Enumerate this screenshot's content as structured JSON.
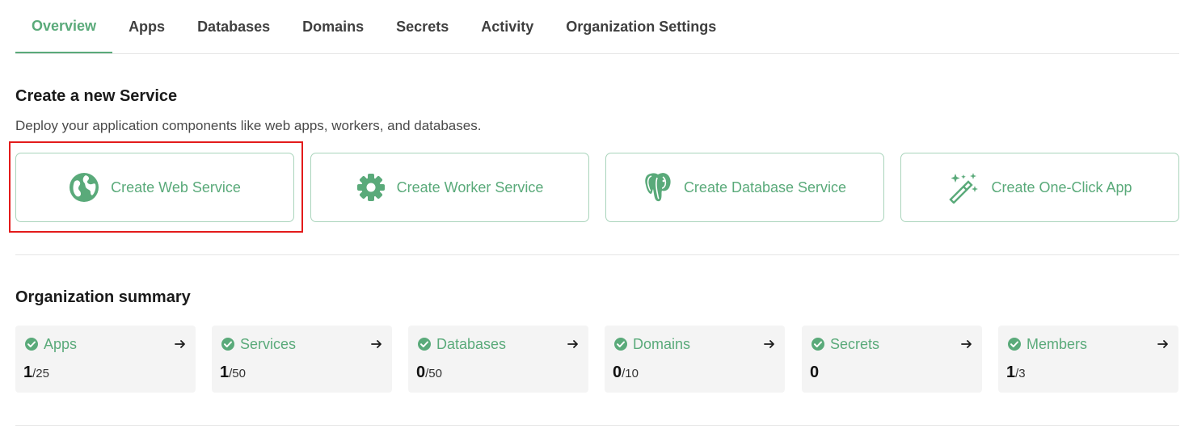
{
  "tabs": [
    {
      "label": "Overview"
    },
    {
      "label": "Apps"
    },
    {
      "label": "Databases"
    },
    {
      "label": "Domains"
    },
    {
      "label": "Secrets"
    },
    {
      "label": "Activity"
    },
    {
      "label": "Organization Settings"
    }
  ],
  "active_tab": "Overview",
  "create_section": {
    "title": "Create a new Service",
    "subtitle": "Deploy your application components like web apps, workers, and databases.",
    "cards": [
      {
        "label": "Create Web Service",
        "icon": "globe-icon"
      },
      {
        "label": "Create Worker Service",
        "icon": "gear-icon"
      },
      {
        "label": "Create Database Service",
        "icon": "postgres-elephant-icon"
      },
      {
        "label": "Create One-Click App",
        "icon": "magic-wand-icon"
      }
    ]
  },
  "summary_section": {
    "title": "Organization summary",
    "items": [
      {
        "label": "Apps",
        "count": "1",
        "limit": "/25"
      },
      {
        "label": "Services",
        "count": "1",
        "limit": "/50"
      },
      {
        "label": "Databases",
        "count": "0",
        "limit": "/50"
      },
      {
        "label": "Domains",
        "count": "0",
        "limit": "/10"
      },
      {
        "label": "Secrets",
        "count": "0",
        "limit": ""
      },
      {
        "label": "Members",
        "count": "1",
        "limit": "/3"
      }
    ]
  },
  "colors": {
    "accent": "#5aaa7a",
    "highlight": "#e31b1b",
    "card_border": "#a9d4bb",
    "summary_bg": "#f4f4f4"
  }
}
